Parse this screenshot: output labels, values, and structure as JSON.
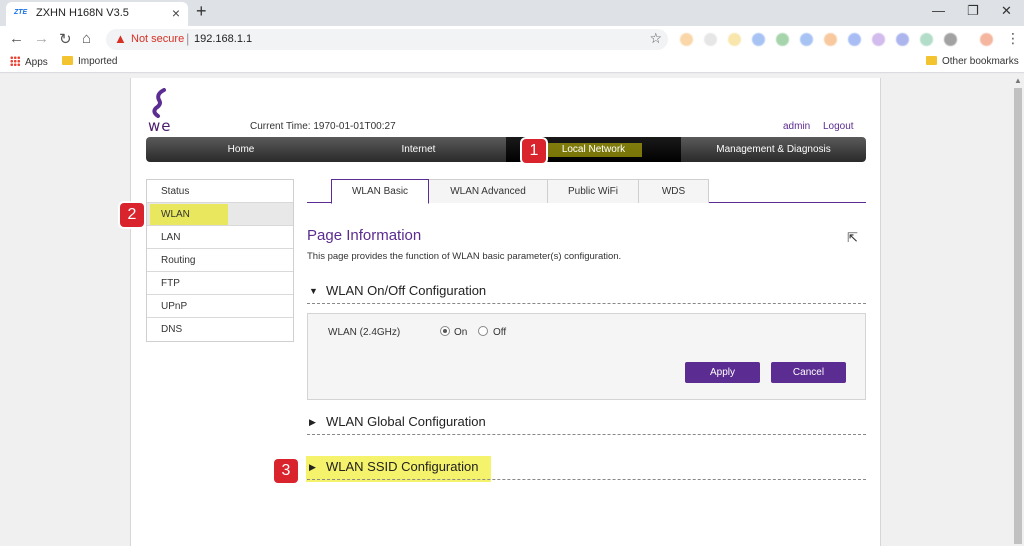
{
  "browser": {
    "tab_title": "ZXHN H168N V3.5",
    "tab_favicon": "ZTE",
    "new_tab": "+",
    "security_label": "Not secure",
    "url": "192.168.1.1",
    "bookmarks": [
      "Apps",
      "Imported"
    ],
    "other_bookmarks": "Other bookmarks"
  },
  "header": {
    "logo_text": "we",
    "current_time_label": "Current Time:",
    "current_time_value": "1970-01-01T00:27",
    "admin": "admin",
    "logout": "Logout"
  },
  "mainnav": [
    {
      "label": "Home"
    },
    {
      "label": "Internet"
    },
    {
      "label": "Local Network"
    },
    {
      "label": "Management & Diagnosis"
    }
  ],
  "sidebar": [
    {
      "label": "Status"
    },
    {
      "label": "WLAN"
    },
    {
      "label": "LAN"
    },
    {
      "label": "Routing"
    },
    {
      "label": "FTP"
    },
    {
      "label": "UPnP"
    },
    {
      "label": "DNS"
    }
  ],
  "tabs": [
    {
      "label": "WLAN Basic"
    },
    {
      "label": "WLAN Advanced"
    },
    {
      "label": "Public WiFi"
    },
    {
      "label": "WDS"
    }
  ],
  "page_info": {
    "title": "Page Information",
    "description": "This page provides the function of WLAN basic parameter(s) configuration."
  },
  "sections": [
    {
      "label": "WLAN On/Off Configuration",
      "expanded": true
    },
    {
      "label": "WLAN Global Configuration",
      "expanded": false
    },
    {
      "label": "WLAN SSID Configuration",
      "expanded": false
    }
  ],
  "wlan_onoff": {
    "field_label": "WLAN (2.4GHz)",
    "options": [
      "On",
      "Off"
    ],
    "selected": "On",
    "apply": "Apply",
    "cancel": "Cancel"
  },
  "annotations": [
    "1",
    "2",
    "3"
  ],
  "colors": {
    "brand_purple": "#5b2c91",
    "badge_red": "#d9232d",
    "highlight_yellow": "#e8e63b"
  }
}
